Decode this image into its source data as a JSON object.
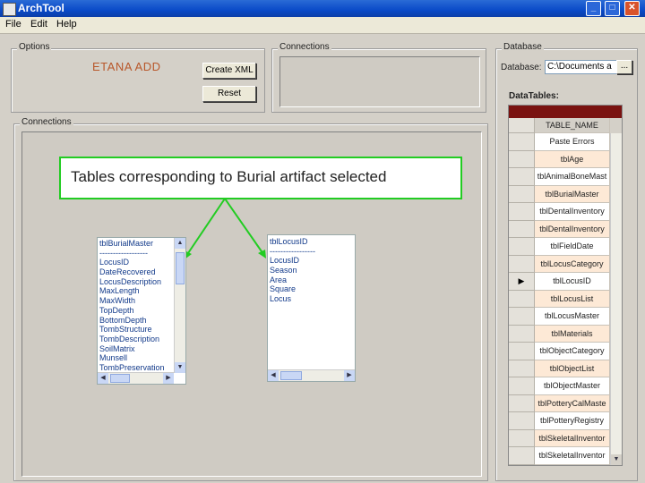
{
  "window": {
    "title": "ArchTool",
    "minimize": "_",
    "maximize": "□",
    "close": "✕"
  },
  "menu": [
    "File",
    "Edit",
    "Help"
  ],
  "options": {
    "label": "Options",
    "etana_add": "ETANA ADD",
    "create_xml": "Create XML",
    "reset": "Reset"
  },
  "connections_top": {
    "label": "Connections"
  },
  "connections_main": {
    "label": "Connections"
  },
  "database": {
    "label": "Database",
    "field_label": "Database:",
    "path": "C:\\Documents a",
    "browse": "...",
    "datatables_label": "DataTables:"
  },
  "callout": {
    "text": "Tables corresponding to Burial artifact selected"
  },
  "burial_list": {
    "items": [
      "tblBurialMaster",
      "------------------",
      "LocusID",
      "DateRecovered",
      "LocusDescription",
      "MaxLength",
      "MaxWidth",
      "TopDepth",
      "BottomDepth",
      "TombStructure",
      "TombDescription",
      "SoilMatrix",
      "Munsell",
      "TombPreservation"
    ]
  },
  "locus_list": {
    "items": [
      "tblLocusID",
      "-----------------",
      "LocusID",
      "Season",
      "Area",
      "Square",
      "Locus"
    ]
  },
  "datatables": {
    "header": "TABLE_NAME",
    "selected_marker": "▶",
    "rows": [
      "Paste Errors",
      "tblAge",
      "tblAnimalBoneMast",
      "tblBurialMaster",
      "tblDentalInventory",
      "tblDentalInventory",
      "tblFieldDate",
      "tblLocusCategory",
      "tblLocusID",
      "tblLocusList",
      "tblLocusMaster",
      "tblMaterials",
      "tblObjectCategory",
      "tblObjectList",
      "tblObjectMaster",
      "tblPotteryCalMaste",
      "tblPotteryRegistry",
      "tblSkeletalInventor",
      "tblSkeletalInventor"
    ],
    "selected_index": 8
  },
  "colors": {
    "grid_header": "#7a1210",
    "row_alt": "#fde9d6",
    "callout_border": "#22cc22",
    "arrow": "#22cc22"
  }
}
